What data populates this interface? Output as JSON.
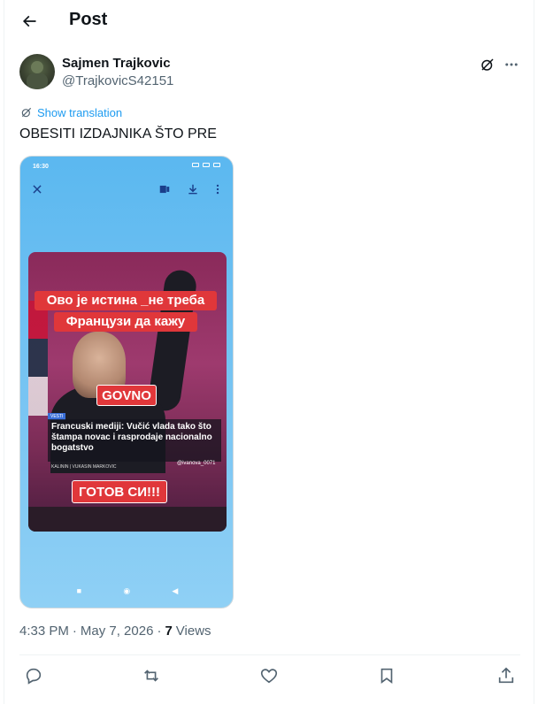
{
  "header": {
    "title": "Post"
  },
  "author": {
    "name": "Sajmen Trajkovic",
    "handle": "@TrajkovicS42151"
  },
  "translation_link": "Show translation",
  "post_text": "OBESITI IZDAJNIKA ŠTO PRE",
  "media": {
    "status_time": "16:30",
    "captions": [
      "Ово је истина _не треба",
      "Французи да кажу",
      "GOVNO",
      "ГОТОВ СИ!!!"
    ],
    "news_tag": "VESTI",
    "news_headline": "Francuski mediji: Vučić vlada tako što štampa novac i rasprodaje nacionalno bogatstvo",
    "news_meta": "KALININ | VUKASIN MARKOVIC",
    "tiktok_handle": "@ivanova_0071"
  },
  "meta": {
    "time": "4:33 PM",
    "separator": "·",
    "date": "May 7, 2026",
    "views": "7",
    "views_label": "Views"
  },
  "icons": {
    "back": "arrow-left-icon",
    "grok": "grok-icon",
    "more": "more-icon",
    "translate": "translate-icon",
    "reply": "reply-icon",
    "repost": "repost-icon",
    "like": "like-icon",
    "bookmark": "bookmark-icon",
    "share": "share-icon"
  },
  "colors": {
    "accent": "#1d9bf0",
    "text": "#0f1419",
    "secondary": "#536471",
    "caption_red": "#e0373a"
  }
}
